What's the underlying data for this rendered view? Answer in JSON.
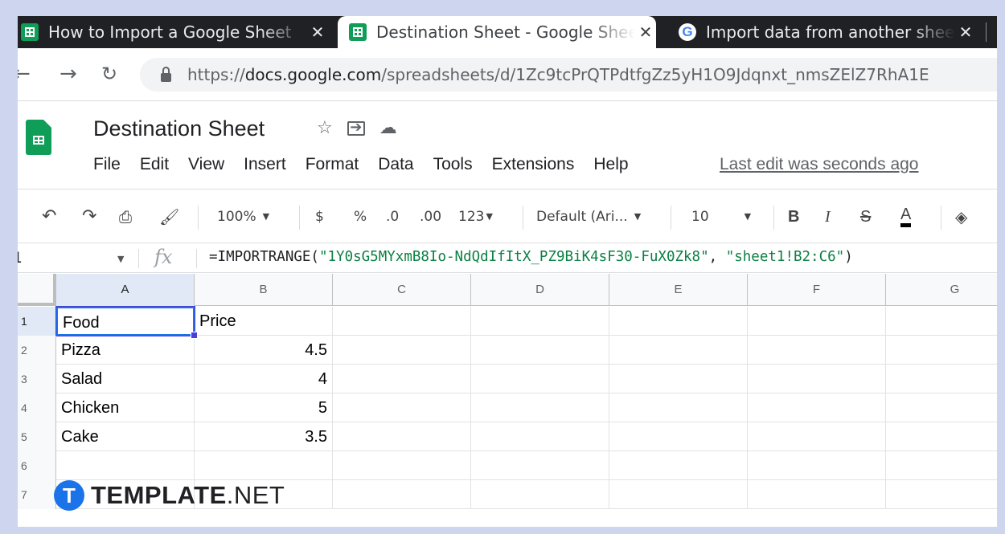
{
  "browser": {
    "tabs": [
      {
        "title": "How to Import a Google Sheet",
        "favicon": "sheets-icon",
        "active": false
      },
      {
        "title": "Destination Sheet - Google Sheets",
        "favicon": "sheets-icon",
        "active": true
      },
      {
        "title": "Import data from another sheet",
        "favicon": "google-icon",
        "active": false
      }
    ],
    "url": {
      "protocol": "https://",
      "host": "docs.google.com",
      "path": "/spreadsheets/d/1Zc9tcPrQTPdtfgZz5yH1O9Jdqnxt_nmsZElZ7RhA1E"
    }
  },
  "doc": {
    "title": "Destination Sheet",
    "menu": [
      "File",
      "Edit",
      "View",
      "Insert",
      "Format",
      "Data",
      "Tools",
      "Extensions",
      "Help"
    ],
    "last_edit": "Last edit was seconds ago"
  },
  "toolbar": {
    "zoom": "100%",
    "currency": "$",
    "percent": "%",
    "decrease_decimal": ".0",
    "increase_decimal": ".00",
    "more_formats": "123",
    "font": "Default (Ari...",
    "font_size": "10",
    "bold": "B",
    "italic": "I",
    "strike": "S",
    "text_color": "A"
  },
  "formula_bar": {
    "name_box": "1",
    "fx": "fx",
    "formula_prefix": "=IMPORTRANGE(",
    "arg1": "\"1Y0sG5MYxmB8Io-NdQdIfItX_PZ9BiK4sF30-FuX0Zk8\"",
    "separator": ", ",
    "arg2": "\"sheet1!B2:C6\"",
    "formula_suffix": ")"
  },
  "grid": {
    "columns": [
      "A",
      "B",
      "C",
      "D",
      "E",
      "F",
      "G"
    ],
    "rows": [
      {
        "num": "1",
        "a": "Food",
        "b": "Price"
      },
      {
        "num": "2",
        "a": "Pizza",
        "b": "4.5"
      },
      {
        "num": "3",
        "a": "Salad",
        "b": "4"
      },
      {
        "num": "4",
        "a": "Chicken",
        "b": "5"
      },
      {
        "num": "5",
        "a": "Cake",
        "b": "3.5"
      },
      {
        "num": "6",
        "a": "",
        "b": ""
      },
      {
        "num": "7",
        "a": "",
        "b": ""
      }
    ]
  },
  "watermark": {
    "logo_letter": "T",
    "brand_bold": "TEMPLATE",
    "brand_light": ".NET"
  },
  "colors": {
    "accent": "#1a73e8",
    "sheets_green": "#0f9d58",
    "formula_string": "#0b8043"
  }
}
